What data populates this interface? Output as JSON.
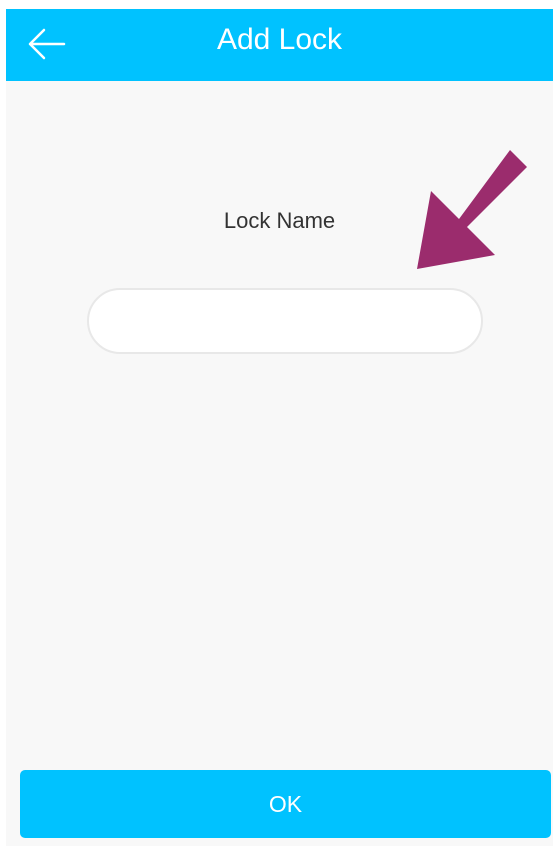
{
  "header": {
    "title": "Add Lock",
    "back_icon": "arrow-left-icon",
    "background_color": "#00c2ff"
  },
  "form": {
    "label": "Lock Name",
    "input_value": "",
    "input_placeholder": ""
  },
  "annotation": {
    "icon": "arrow-down-left-icon",
    "color": "#9b2c6d"
  },
  "footer": {
    "ok_label": "OK",
    "button_color": "#00c2ff"
  }
}
